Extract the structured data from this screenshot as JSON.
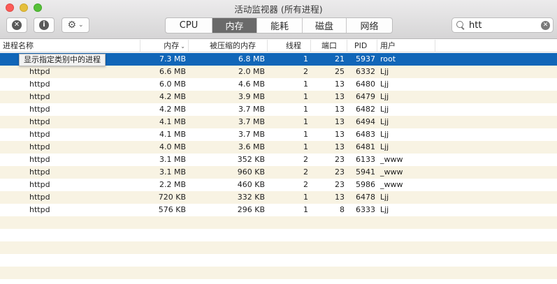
{
  "window": {
    "title": "活动监视器 (所有进程)"
  },
  "toolbar": {
    "tabs": [
      {
        "label": "CPU",
        "active": false
      },
      {
        "label": "内存",
        "active": true
      },
      {
        "label": "能耗",
        "active": false
      },
      {
        "label": "磁盘",
        "active": false
      },
      {
        "label": "网络",
        "active": false
      }
    ],
    "search": {
      "value": "htt"
    },
    "icons": {
      "stop": "stop-process-icon",
      "info": "info-icon",
      "gear": "gear-icon",
      "search": "search-icon",
      "clear": "clear-search-icon"
    }
  },
  "table": {
    "columns": {
      "name": "进程名称",
      "memory": "内存",
      "compressed": "被压缩的内存",
      "threads": "线程",
      "ports": "端口",
      "pid": "PID",
      "user": "用户"
    },
    "tooltip": "显示指定类别中的进程",
    "rows": [
      {
        "name": "",
        "memory": "7.3 MB",
        "compressed": "6.8 MB",
        "threads": "1",
        "ports": "21",
        "pid": "5937",
        "user": "root"
      },
      {
        "name": "httpd",
        "memory": "6.6 MB",
        "compressed": "2.0 MB",
        "threads": "2",
        "ports": "25",
        "pid": "6332",
        "user": "Ljj"
      },
      {
        "name": "httpd",
        "memory": "6.0 MB",
        "compressed": "4.6 MB",
        "threads": "1",
        "ports": "13",
        "pid": "6480",
        "user": "Ljj"
      },
      {
        "name": "httpd",
        "memory": "4.2 MB",
        "compressed": "3.9 MB",
        "threads": "1",
        "ports": "13",
        "pid": "6479",
        "user": "Ljj"
      },
      {
        "name": "httpd",
        "memory": "4.2 MB",
        "compressed": "3.7 MB",
        "threads": "1",
        "ports": "13",
        "pid": "6482",
        "user": "Ljj"
      },
      {
        "name": "httpd",
        "memory": "4.1 MB",
        "compressed": "3.7 MB",
        "threads": "1",
        "ports": "13",
        "pid": "6494",
        "user": "Ljj"
      },
      {
        "name": "httpd",
        "memory": "4.1 MB",
        "compressed": "3.7 MB",
        "threads": "1",
        "ports": "13",
        "pid": "6483",
        "user": "Ljj"
      },
      {
        "name": "httpd",
        "memory": "4.0 MB",
        "compressed": "3.6 MB",
        "threads": "1",
        "ports": "13",
        "pid": "6481",
        "user": "Ljj"
      },
      {
        "name": "httpd",
        "memory": "3.1 MB",
        "compressed": "352 KB",
        "threads": "2",
        "ports": "23",
        "pid": "6133",
        "user": "_www"
      },
      {
        "name": "httpd",
        "memory": "3.1 MB",
        "compressed": "960 KB",
        "threads": "2",
        "ports": "23",
        "pid": "5941",
        "user": "_www"
      },
      {
        "name": "httpd",
        "memory": "2.2 MB",
        "compressed": "460 KB",
        "threads": "2",
        "ports": "23",
        "pid": "5986",
        "user": "_www"
      },
      {
        "name": "httpd",
        "memory": "720 KB",
        "compressed": "332 KB",
        "threads": "1",
        "ports": "13",
        "pid": "6478",
        "user": "Ljj"
      },
      {
        "name": "httpd",
        "memory": "576 KB",
        "compressed": "296 KB",
        "threads": "1",
        "ports": "8",
        "pid": "6333",
        "user": "Ljj"
      }
    ],
    "empty_rows": 5,
    "selected_index": 0
  },
  "colors": {
    "selection": "#1166b8",
    "alt_row": "#f8f3e3",
    "active_tab": "#6a6a6a"
  }
}
